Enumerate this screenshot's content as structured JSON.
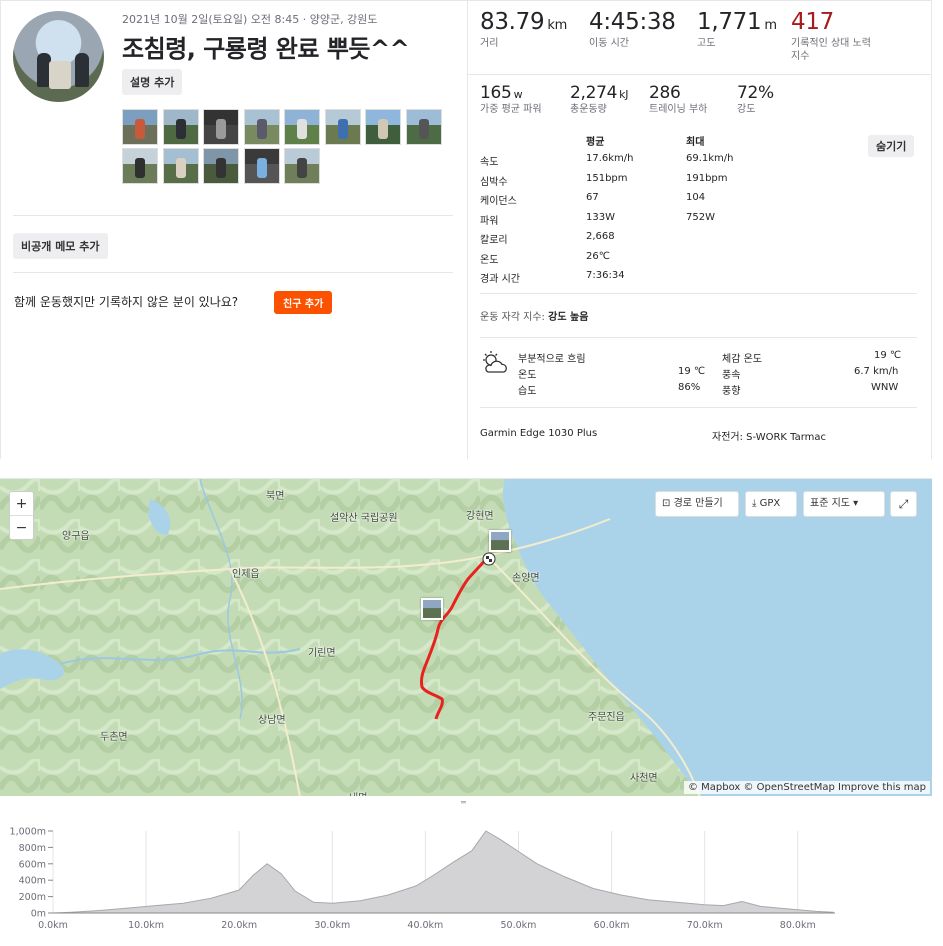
{
  "header": {
    "meta": "2021년 10월 2일(토요일) 오전 8:45 · 양양군, 강원도",
    "title": "조침령, 구룡령 완료 뿌듯^^",
    "add_description": "설명 추가",
    "photo_count": 13
  },
  "notes": {
    "private_note": "비공개 메모 추가",
    "friends_question": "함께 운동했지만 기록하지 않은 분이 있나요?",
    "add_friend": "친구 추가"
  },
  "stats": {
    "distance": {
      "value": "83.79",
      "unit": "km",
      "label": "거리"
    },
    "moving_time": {
      "value": "4:45:38",
      "label": "이동 시간"
    },
    "elevation": {
      "value": "1,771",
      "unit": "m",
      "label": "고도"
    },
    "relative_effort": {
      "value": "417",
      "label": "기록적인 상대 노력 지수"
    },
    "power": {
      "value": "165",
      "unit": "w",
      "label": "가중 평균 파워"
    },
    "energy": {
      "value": "2,274",
      "unit": "kJ",
      "label": "총운동량"
    },
    "training_load": {
      "value": "286",
      "label": "트레이닝 부하"
    },
    "intensity": {
      "value": "72%",
      "label": "강도"
    }
  },
  "details": {
    "hide": "숨기기",
    "headers": [
      "평균",
      "최대"
    ],
    "rows": [
      {
        "label": "속도",
        "avg": "17.6km/h",
        "max": "69.1km/h"
      },
      {
        "label": "심박수",
        "avg": "151bpm",
        "max": "191bpm"
      },
      {
        "label": "케이던스",
        "avg": "67",
        "max": "104"
      },
      {
        "label": "파워",
        "avg": "133W",
        "max": "752W"
      },
      {
        "label": "칼로리",
        "avg": "2,668",
        "max": ""
      },
      {
        "label": "온도",
        "avg": "26℃",
        "max": ""
      },
      {
        "label": "경과 시간",
        "avg": "7:36:34",
        "max": ""
      }
    ],
    "perceived_label": "운동 자각 지수:",
    "perceived_value": "강도 높음"
  },
  "weather": {
    "condition": "부분적으로 흐림",
    "temp_label": "온도",
    "temp": "19 ℃",
    "humidity_label": "습도",
    "humidity": "86%",
    "feels_label": "체감 온도",
    "feels": "19 ℃",
    "wind_label": "풍속",
    "wind": "6.7 km/h",
    "dir_label": "풍향",
    "dir": "WNW",
    "icon": "partly-cloudy-icon"
  },
  "gear": {
    "device": "Garmin Edge 1030 Plus",
    "bike": "자전거: S-WORK Tarmac"
  },
  "map": {
    "zoom_in": "+",
    "zoom_out": "−",
    "route_builder": "경로 만들기",
    "gpx": "GPX",
    "map_type": "표준 지도",
    "attribution": "© Mapbox © OpenStreetMap Improve this map",
    "place_labels": [
      "북면",
      "설악산 국립공원",
      "강현면",
      "양구읍",
      "인제읍",
      "손양면",
      "기린면",
      "상남면",
      "두촌면",
      "주문진읍",
      "사천면",
      "내면"
    ],
    "route_color": "#e8231f",
    "water_color": "#aad3ea"
  },
  "elevation_chart": {
    "type": "area",
    "y_ticks": [
      "1,000m",
      "800m",
      "600m",
      "400m",
      "200m",
      "0m"
    ],
    "x_ticks": [
      "0.0km",
      "10.0km",
      "20.0km",
      "30.0km",
      "40.0km",
      "50.0km",
      "60.0km",
      "70.0km",
      "80.0km"
    ],
    "ylim": [
      0,
      1000
    ],
    "xlim": [
      0,
      84
    ],
    "x": [
      0,
      2,
      5,
      8,
      11,
      14,
      17,
      20,
      21.5,
      23,
      24.5,
      26,
      28,
      30,
      33,
      36,
      39,
      41,
      43,
      45,
      46.5,
      48,
      50,
      52,
      55,
      58,
      61,
      64,
      67,
      70,
      72,
      74,
      76,
      78,
      80,
      82,
      83.8
    ],
    "values": [
      0,
      10,
      30,
      60,
      90,
      120,
      180,
      280,
      460,
      600,
      480,
      270,
      130,
      120,
      150,
      220,
      330,
      470,
      620,
      760,
      1000,
      900,
      750,
      600,
      440,
      300,
      220,
      160,
      130,
      100,
      90,
      140,
      80,
      60,
      40,
      20,
      10
    ]
  }
}
